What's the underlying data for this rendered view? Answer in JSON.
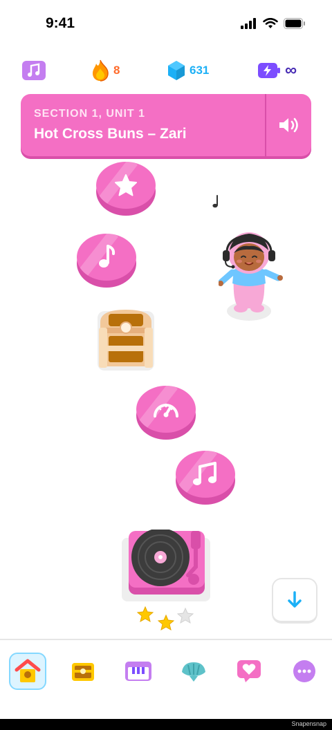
{
  "status_bar": {
    "time": "9:41"
  },
  "stats": {
    "course_icon": "music-note-icon",
    "streak_count": "8",
    "gems_count": "631",
    "energy_value": "∞"
  },
  "unit": {
    "section": "SECTION 1, UNIT 1",
    "title": "Hot Cross Buns – Zari"
  },
  "path": {
    "nodes": [
      {
        "type": "star-icon"
      },
      {
        "type": "music-note-icon"
      },
      {
        "type": "treasure-chest-icon"
      },
      {
        "type": "speedometer-icon"
      },
      {
        "type": "music-notes-icon"
      },
      {
        "type": "turntable-icon"
      }
    ],
    "stars_earned": 2,
    "stars_total": 3
  },
  "tabs": [
    "home-icon",
    "quests-chest-icon",
    "piano-icon",
    "shell-icon",
    "heart-icon",
    "more-icon"
  ],
  "colors": {
    "unit_pink": "#f46fc4",
    "unit_pink_dark": "#d94fa9",
    "gem_blue": "#1cb0f6",
    "streak_orange": "#ff6b2b",
    "energy_purple": "#7c4dff"
  },
  "watermark": "Snapensnap"
}
